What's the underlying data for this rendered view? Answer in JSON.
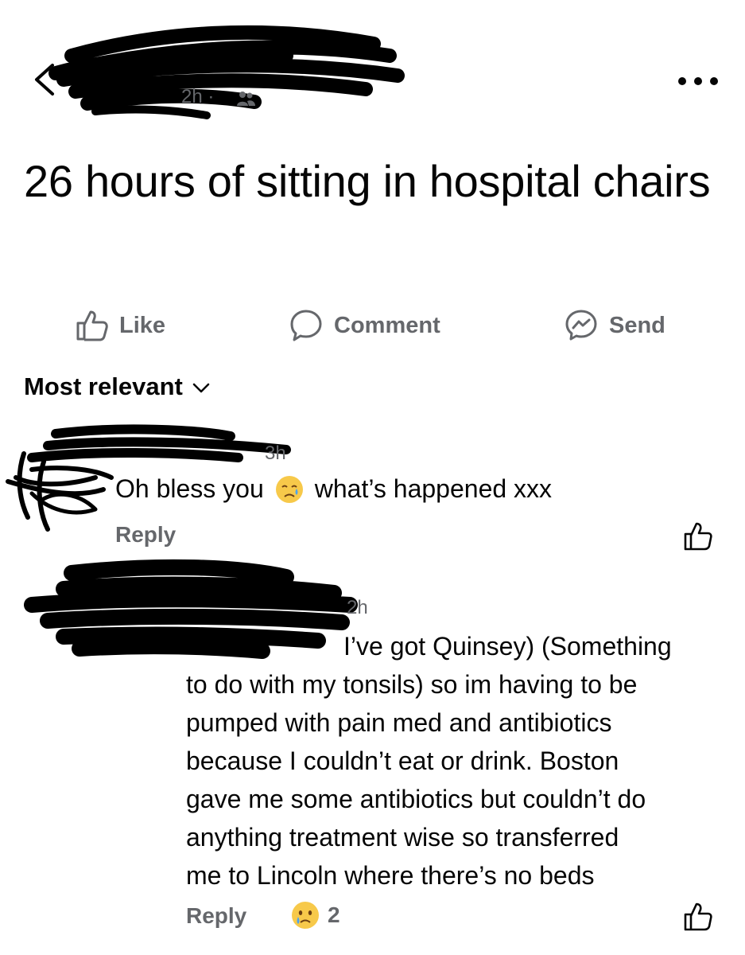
{
  "header": {
    "time": "2h",
    "separator": "·",
    "back_icon": "chevron-left-icon",
    "more_icon": "more-horizontal-icon",
    "audience_icon": "friends-icon"
  },
  "post": {
    "text": "26 hours of sitting in hospital chairs"
  },
  "actions": {
    "like": "Like",
    "comment": "Comment",
    "send": "Send"
  },
  "comments_sort": {
    "label": "Most relevant"
  },
  "comments": [
    {
      "time": "3h",
      "text_before_emoji": "Oh bless you",
      "emoji": "crying-face",
      "text_after_emoji": "what’s happened xxx",
      "reply_label": "Reply"
    },
    {
      "time": "2h",
      "first_line": "I’ve got Quinsey) (Something",
      "body": "to do with my tonsils) so im having to be\npumped with pain med and antibiotics\nbecause I couldn’t eat or drink. Boston\ngave me some antibiotics but couldn’t do\nanything treatment wise so transferred\nme to Lincoln where there’s no beds",
      "reply_label": "Reply",
      "reaction_emoji": "sad-face",
      "reaction_count": "2"
    }
  ],
  "colors": {
    "text": "#050505",
    "secondary": "#65676b",
    "scribble": "#000000",
    "emoji_yellow": "#f7c94a"
  }
}
